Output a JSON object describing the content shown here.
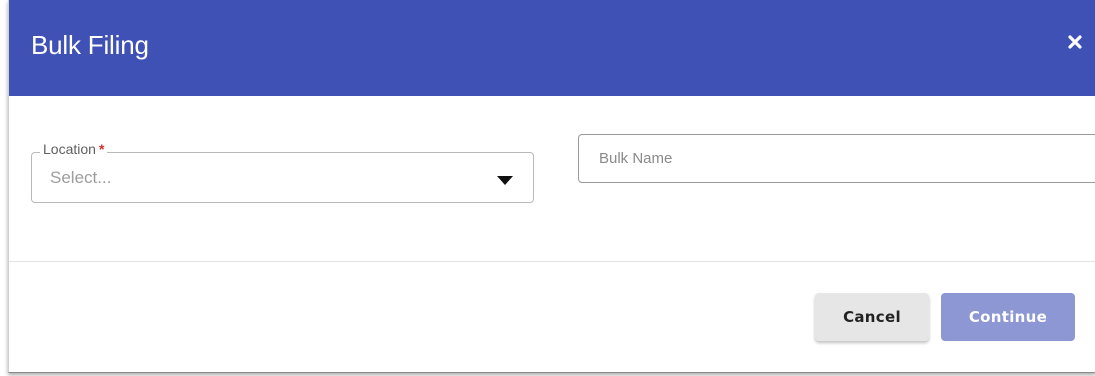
{
  "dialog": {
    "title": "Bulk Filing",
    "close_icon": "close-icon"
  },
  "form": {
    "location": {
      "label": "Location",
      "required_marker": "*",
      "value": "Select...",
      "dropdown_icon": "caret-down-icon"
    },
    "bulk_name": {
      "placeholder": "Bulk Name",
      "value": ""
    }
  },
  "actions": {
    "cancel_label": "Cancel",
    "continue_label": "Continue"
  },
  "colors": {
    "header": "#3f51b5",
    "primary_disabled": "#8c97d4",
    "required": "#d32f2f",
    "secondary_button": "#e6e6e6"
  }
}
